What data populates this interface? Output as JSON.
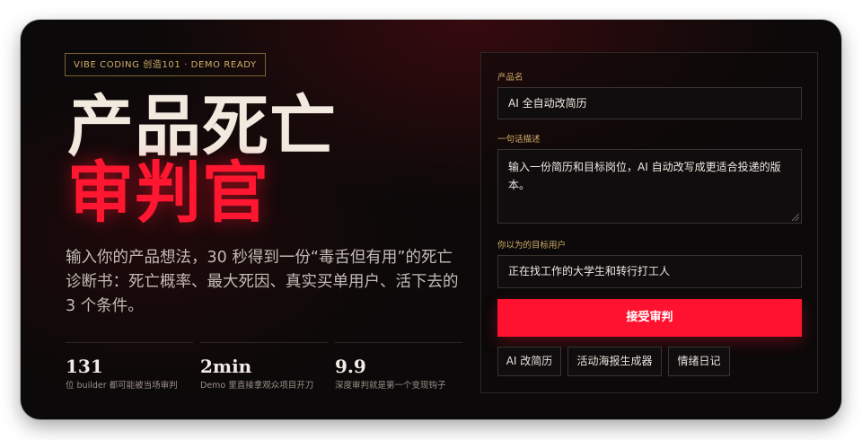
{
  "hero": {
    "tag": "VIBE CODING 创造101 · DEMO READY",
    "title_line1": "产品死亡",
    "title_line2": "审判官",
    "subtitle": "输入你的产品想法，30 秒得到一份“毒舌但有用”的死亡诊断书：死亡概率、最大死因、真实买单用户、活下去的 3 个条件。"
  },
  "stats": [
    {
      "value": "131",
      "desc": "位 builder 都可能被当场审判"
    },
    {
      "value": "2min",
      "desc": "Demo 里直接拿观众项目开刀"
    },
    {
      "value": "9.9",
      "desc": "深度审判就是第一个变现钩子"
    }
  ],
  "form": {
    "product_name_label": "产品名",
    "product_name_value": "AI 全自动改简历",
    "description_label": "一句话描述",
    "description_value": "输入一份简历和目标岗位，AI 自动改写成更适合投递的版本。",
    "target_user_label": "你以为的目标用户",
    "target_user_value": "正在找工作的大学生和转行打工人",
    "submit_label": "接受审判",
    "examples": [
      "AI 改简历",
      "活动海报生成器",
      "情绪日记"
    ]
  },
  "colors": {
    "accent_red": "#ff1230",
    "gold": "#d2ae6a",
    "background": "#0b0909"
  }
}
